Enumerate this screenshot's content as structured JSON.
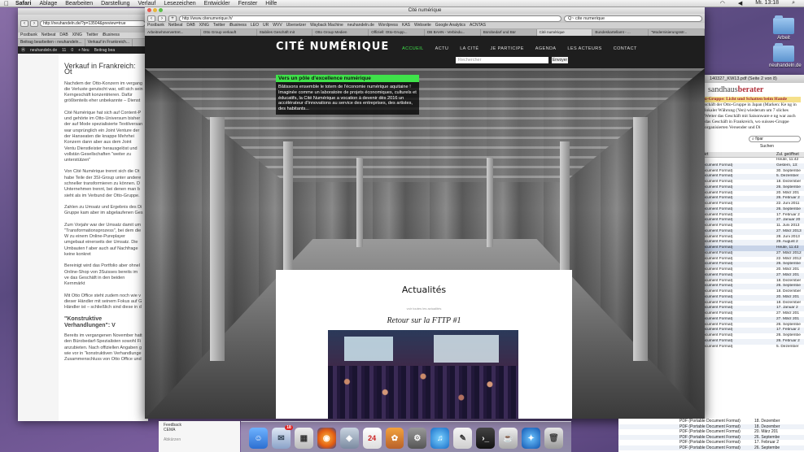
{
  "menubar": {
    "items": [
      "Safari",
      "Ablage",
      "Bearbeiten",
      "Darstellung",
      "Verlauf",
      "Lesezeichen",
      "Entwickler",
      "Fenster",
      "Hilfe"
    ],
    "clock": "Mi. 13:18"
  },
  "desktop": {
    "icons": [
      {
        "label": "Arbeit"
      },
      {
        "label": "neuhandeln.de"
      }
    ]
  },
  "back_window": {
    "url": "http://neuhandeln.de/?p=13504&preview=true",
    "bookmarks": [
      "Postbank",
      "Netbeat",
      "DAB",
      "XING",
      "Twitter",
      "iBusiness",
      "LEO",
      "UR"
    ],
    "tabs": [
      "Beitrag bearbeiten ‹ neuhandeln...",
      "Verkauf in Frankreich..."
    ],
    "wp_bar": [
      "neuhandeln.de",
      "11",
      "0",
      "+ Neu",
      "Beitrag bea"
    ],
    "article": {
      "title": "Verkauf in Frankreich: Ot",
      "p1": "Nachdem der Otto-Konzern im vergang die Verluste gerutscht war, will sich sein Kerngeschäft konzentrieren. Dafür größtenteils eher unbekannte – Dienst",
      "p2": "Cité Numérique hat sich auf Content-P und gehörte im Otto-Universum bisher der auf Mode spezialisierte Textilversan war ursprünglich ein Joint Venture der der Hanseaten die knappe Mehrhei Konzern dann aber aus dem Joint Ventu Dienstleister herausgelöst und vollstän Gesellschaften \"weiter zu unterstützen\"",
      "p3": "Von Cité Numérique trennt sich die Ot habe Teile der 3SI-Group unter andere schneller transformieren zu können. D Unternehmen trennt, bei denen man b sieht als im Verbund der Otto-Gruppe.",
      "p4": "Zahlen zu Umsatz und Ergebnis des Di Gruppe kam aber im abgelaufenen Ges",
      "p5": "Zum Vorjahr war der Umsatz damit um \"Transformationsprozess\", bei dem die W zu einem Online-Pureplayer umgebaut einerseits der Umsatz. Die Umbauten f aber auch auf Nachfrage keine konkret",
      "p6": "Bereinigt wird das Portfolio aber ohnel Online-Shop von 3Suisses bereits im ve das Geschäft in den beiden Kernmärkt",
      "p7": "Mit Otto Office steht zudem noch wie v dieser Händler mit seinem Fokus auf G Händler ist – schließlich sind diese in d",
      "h3": "\"Konstruktive Verhandlungen\": V",
      "p8": "Bereits im vergangenen November hatt den Bürobedarf-Spezialisten sowohl Fi anzubieten. Nach offiziellen Angaben g wie vor in \"konstruktiven Verhandlunge Zusammenschluss von Otto Office und"
    }
  },
  "main_window": {
    "title": "Cité numérique",
    "url": "http://www.citenumerique.fr/",
    "search": "Q~ cite numerique",
    "bookmarks": [
      "Postbank",
      "Netbeat",
      "DAB",
      "XING",
      "Twitter",
      "iBusiness",
      "LEO",
      "UR",
      "WVV",
      "Übersetzer",
      "Wayback Machine",
      "neuhandeln.de",
      "Wordpress",
      "KAS",
      "Webseite",
      "Google Analytics",
      "ACNTAS"
    ],
    "tabs": [
      "Arbeitnehmervertret...",
      "Otto Group verkauft",
      "Stabiles Geschäft mit",
      "Otto Group Medien",
      "Offiziell: Otto-Grupp...",
      "DB BAHN - Verbindu...",
      "Bürobedarf und Bür",
      "Cité numérique",
      "Bundeskartellamt - ...",
      "\"Modernisierungsstr..."
    ],
    "active_tab": 7
  },
  "site": {
    "logo": "CITÉ NUMÉRIQUE",
    "nav": [
      "ACCUEIL",
      "ACTU",
      "LA CITÉ",
      "JE PARTICIPE",
      "AGENDA",
      "LES ACTEURS",
      "CONTACT"
    ],
    "search_placeholder": "Rechercher",
    "search_button": "Envoyer",
    "overlay_title": "Vers un pôle d'excellence numérique",
    "overlay_text": "Bâtissons ensemble le totem de l'économie numérique aquitaine ! Imaginée comme un laboratoire de projets économiques, culturels et éducatifs, la Cité Numérique a vocation à devenir dès 2016 un accélérateur d'innovations au service des entreprises, des artistes, des habitants...",
    "news_heading": "Actualités",
    "news_link": "voir toutes les actualités",
    "post_title": "Retour sur la FTTP #1"
  },
  "pdf_window": {
    "title": "140327_KW13.pdf (Seite 2 von 8)",
    "brand_a": "sandhaus",
    "brand_b": "berater",
    "headline": "o-Gruppe: Licht und Schatten beim Hande",
    "text": "schäft der Otto-Gruppe in Japan (Marken: Ke ng in lokaler Währung (Yen) wiederum um 7 sliches Wetter das Geschäft mit Saisonware e ng war auch das Geschäft in Frankreich, wo suisses-Gruppe organisierten Versender und Di",
    "search_value": "fipar",
    "search_label": "Suchen",
    "col1": "Art",
    "col2": "Zul. geöffnet",
    "rows": [
      [
        "",
        "Heute, 11:42"
      ],
      [
        "ocument Format)",
        "Gestern, 13:"
      ],
      [
        "ocument Format)",
        "30. Septembe"
      ],
      [
        "ocument Format)",
        "5. Dezember"
      ],
      [
        "ocument Format)",
        "18. Dezember"
      ],
      [
        "ocument Format)",
        "26. Septembe"
      ],
      [
        "ocument Format)",
        "20. März 201"
      ],
      [
        "ocument Format)",
        "26. Februar 2"
      ],
      [
        "ocument Format)",
        "22. Juni 2011"
      ],
      [
        "ocument Format)",
        "26. Septembe"
      ],
      [
        "ocument Format)",
        "17. Februar 2"
      ],
      [
        "ocument Format)",
        "27. Januar 20"
      ],
      [
        "ocument Format)",
        "11. Juni 2013"
      ],
      [
        "ocument Format)",
        "27. März 2013"
      ],
      [
        "ocument Format)",
        "28. Juni 2013"
      ],
      [
        "ocument Format)",
        "29. August 2"
      ],
      [
        "ocument Format)",
        "Heute, 11:43"
      ],
      [
        "ocument Format)",
        "27. März 2012"
      ],
      [
        "ocument Format)",
        "22. März 2012"
      ],
      [
        "ocument Format)",
        "26. Septembe"
      ],
      [
        "ocument Format)",
        "20. März 201"
      ],
      [
        "ocument Format)",
        "27. März 201"
      ],
      [
        "ocument Format)",
        "18. Dezember"
      ],
      [
        "ocument Format)",
        "26. Septembe"
      ],
      [
        "ocument Format)",
        "18. Dezember"
      ],
      [
        "ocument Format)",
        "20. März 201"
      ],
      [
        "ocument Format)",
        "18. Dezember"
      ],
      [
        "ocument Format)",
        "17. Januar 2"
      ],
      [
        "ocument Format)",
        "27. März 201"
      ],
      [
        "ocument Format)",
        "27. März 201"
      ],
      [
        "ocument Format)",
        "26. Septembe"
      ],
      [
        "ocument Format)",
        "17. Februar 2"
      ],
      [
        "ocument Format)",
        "26. Septembe"
      ],
      [
        "ocument Format)",
        "26. Februar 2"
      ],
      [
        "ocument Format)",
        "5. Dezember"
      ]
    ],
    "bottom_rows": [
      [
        "PDF (Portable Document Format)",
        "18. Dezember"
      ],
      [
        "PDF (Portable Document Format)",
        "18. Dezember"
      ],
      [
        "PDF (Portable Document Format)",
        "20. März 201"
      ],
      [
        "PDF (Portable Document Format)",
        "26. Septembe"
      ],
      [
        "PDF (Portable Document Format)",
        "17. Februar 2"
      ],
      [
        "PDF (Portable Document Format)",
        "26. Septembe"
      ]
    ]
  },
  "finder": {
    "items": [
      "Feedback",
      "CEMA",
      "Abkürzen"
    ]
  },
  "dock": {
    "mail_badge": "18",
    "calendar_day": "24"
  }
}
